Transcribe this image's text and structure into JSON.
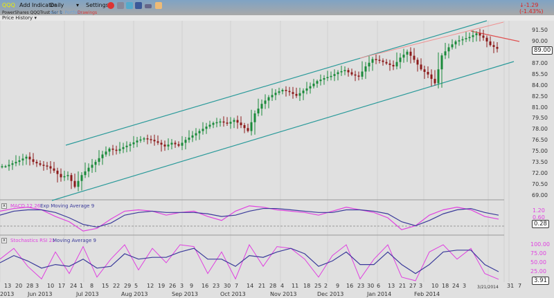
{
  "toolbar": {
    "symbol": "QQQ",
    "add_indicator": "Add Indicator",
    "interval": "Daily",
    "settings": "Settings",
    "change": "-1.29 (-1.43%)",
    "icons": [
      "alarm-icon",
      "trade-icon",
      "twitter-icon",
      "facebook-icon",
      "share-icon",
      "note-icon"
    ]
  },
  "subbar": {
    "name": "PowerShares QQQTrust Ser 1",
    "add_portfolio": "Add to Portfolio",
    "drawings": "Drawings"
  },
  "panel_title": "Price History",
  "colors": {
    "up": "#1a8a3a",
    "down": "#8b1a1a",
    "channel": "#2a9a9a",
    "resist": "#e06060",
    "macd": "#e040e0",
    "signal": "#3a3a9a"
  },
  "chart_data": [
    {
      "type": "candlestick",
      "title": "Price History",
      "ylim": [
        69,
        92.5
      ],
      "yticks": [
        "91.50",
        "90.00",
        "87.00",
        "85.50",
        "84.00",
        "82.50",
        "81.00",
        "79.50",
        "78.00",
        "76.50",
        "75.00",
        "73.50",
        "72.00",
        "70.50",
        "69.00"
      ],
      "last_price": "89.00",
      "closes": [
        73.0,
        73.4,
        73.8,
        74.3,
        73.6,
        73.2,
        73.0,
        72.4,
        71.5,
        71.8,
        70.2,
        71.8,
        72.8,
        73.6,
        74.6,
        75.4,
        75.1,
        75.6,
        76.0,
        76.5,
        76.8,
        76.6,
        76.2,
        75.7,
        76.2,
        75.8,
        76.6,
        77.2,
        77.8,
        78.4,
        78.9,
        79.1,
        78.8,
        79.3,
        78.6,
        77.8,
        80.2,
        81.5,
        82.4,
        83.0,
        83.4,
        83.1,
        82.6,
        83.3,
        83.9,
        84.6,
        85.0,
        85.3,
        85.8,
        86.1,
        85.5,
        85.2,
        86.6,
        87.6,
        87.4,
        87.0,
        86.6,
        87.8,
        88.6,
        87.5,
        86.2,
        85.5,
        84.3,
        88.1,
        89.2,
        90.0,
        90.3,
        90.6,
        91.1,
        90.5,
        89.5,
        89.0
      ]
    },
    {
      "type": "line",
      "title": "MACD 12 26",
      "signal_title": "Exp Moving Average 9",
      "ylim": [
        -0.8,
        1.6
      ],
      "yticks": [
        "1.20",
        "0.60"
      ],
      "last": "0.28",
      "macd": [
        0.9,
        1.1,
        1.2,
        1.0,
        0.5,
        0.1,
        -0.6,
        -0.4,
        0.3,
        0.9,
        1.0,
        0.9,
        0.6,
        0.8,
        0.9,
        0.5,
        0.2,
        0.9,
        1.3,
        1.2,
        1.0,
        0.9,
        0.8,
        0.6,
        0.9,
        1.2,
        1.0,
        0.8,
        0.4,
        -0.5,
        -0.2,
        0.6,
        1.0,
        1.2,
        1.0,
        0.5,
        0.3
      ],
      "signal": [
        0.6,
        0.9,
        1.0,
        1.0,
        0.8,
        0.4,
        -0.1,
        -0.3,
        0.0,
        0.6,
        0.8,
        0.9,
        0.8,
        0.8,
        0.8,
        0.7,
        0.5,
        0.6,
        0.9,
        1.1,
        1.1,
        1.0,
        0.9,
        0.8,
        0.8,
        1.0,
        1.0,
        0.9,
        0.7,
        0.1,
        -0.2,
        0.2,
        0.7,
        1.0,
        1.1,
        0.8,
        0.6
      ]
    },
    {
      "type": "line",
      "title": "Stochastics RSI 21",
      "ma_title": "Moving Average 9",
      "ylim": [
        0,
        100
      ],
      "yticks": [
        "100.00",
        "75.00",
        "50.00",
        "25.00"
      ],
      "last": "3.91",
      "rsi": [
        60,
        90,
        40,
        5,
        80,
        20,
        95,
        10,
        60,
        100,
        30,
        90,
        50,
        100,
        95,
        20,
        80,
        5,
        100,
        40,
        95,
        90,
        60,
        10,
        70,
        100,
        5,
        60,
        100,
        10,
        0,
        80,
        100,
        60,
        90,
        20,
        4
      ],
      "ma": [
        50,
        70,
        55,
        35,
        45,
        40,
        60,
        35,
        40,
        75,
        60,
        65,
        65,
        80,
        90,
        60,
        60,
        40,
        70,
        65,
        80,
        90,
        75,
        40,
        55,
        80,
        45,
        45,
        80,
        45,
        20,
        45,
        80,
        85,
        85,
        45,
        25
      ]
    },
    {
      "type": "axis",
      "days": [
        "13",
        "20",
        "28",
        "3",
        "10",
        "17",
        "24",
        "1",
        "8",
        "15",
        "22",
        "29",
        "5",
        "12",
        "19",
        "26",
        "3",
        "9",
        "16",
        "23",
        "30",
        "7",
        "14",
        "21",
        "28",
        "4",
        "11",
        "18",
        "25",
        "2",
        "9",
        "16",
        "23",
        "30",
        "6",
        "13",
        "21",
        "27",
        "3",
        "10",
        "18",
        "24",
        "3",
        "3/21/2014",
        "31",
        "7"
      ],
      "months": [
        "2013",
        "Jun 2013",
        "Jul 2013",
        "Aug 2013",
        "Sep 2013",
        "Oct 2013",
        "Nov 2013",
        "Dec 2013",
        "Jan 2014",
        "Feb 2014"
      ]
    }
  ]
}
